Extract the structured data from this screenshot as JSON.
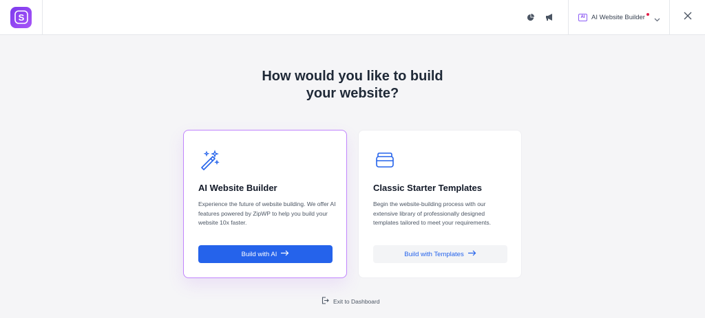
{
  "header": {
    "logo_letter": "S",
    "logo_icon": "starter-templates-logo-icon",
    "utility_icons": [
      "pie-chart-icon",
      "megaphone-icon"
    ],
    "mode_badge_text": "AI",
    "mode_label": "AI Website Builder",
    "notification_dot_color": "#e11d48",
    "close_icon": "close-icon"
  },
  "main": {
    "heading_line1": "How would you like to build",
    "heading_line2": "your website?",
    "cards": [
      {
        "icon": "magic-wand-icon",
        "title": "AI Website Builder",
        "description": "Experience the future of website building. We offer AI features powered by ZipWP to help you build your website 10x faster.",
        "button_label": "Build with AI",
        "selected": true
      },
      {
        "icon": "stacked-boxes-icon",
        "title": "Classic Starter Templates",
        "description": "Begin the website-building process with our extensive library of professionally designed templates tailored to meet your requirements.",
        "button_label": "Build with Templates",
        "selected": false
      }
    ]
  },
  "footer": {
    "exit_label": "Exit to Dashboard",
    "exit_icon": "exit-icon"
  },
  "colors": {
    "accent": "#2563eb",
    "brand_purple": "#8b5cf6",
    "background": "#f5f5f7"
  }
}
